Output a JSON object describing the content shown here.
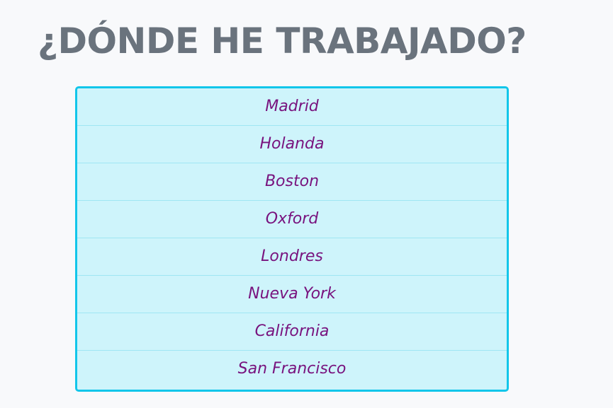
{
  "heading": {
    "title": "¿DÓNDE HE TRABAJADO?"
  },
  "places": [
    "Madrid",
    "Holanda",
    "Boston",
    "Oxford",
    "Londres",
    "Nueva York",
    "California",
    "San Francisco"
  ],
  "colors": {
    "title": "#6a737d",
    "box_border": "#12c6ea",
    "box_background": "#cef4fb",
    "item_text": "#78137e",
    "page_background": "#f8f9fb"
  }
}
